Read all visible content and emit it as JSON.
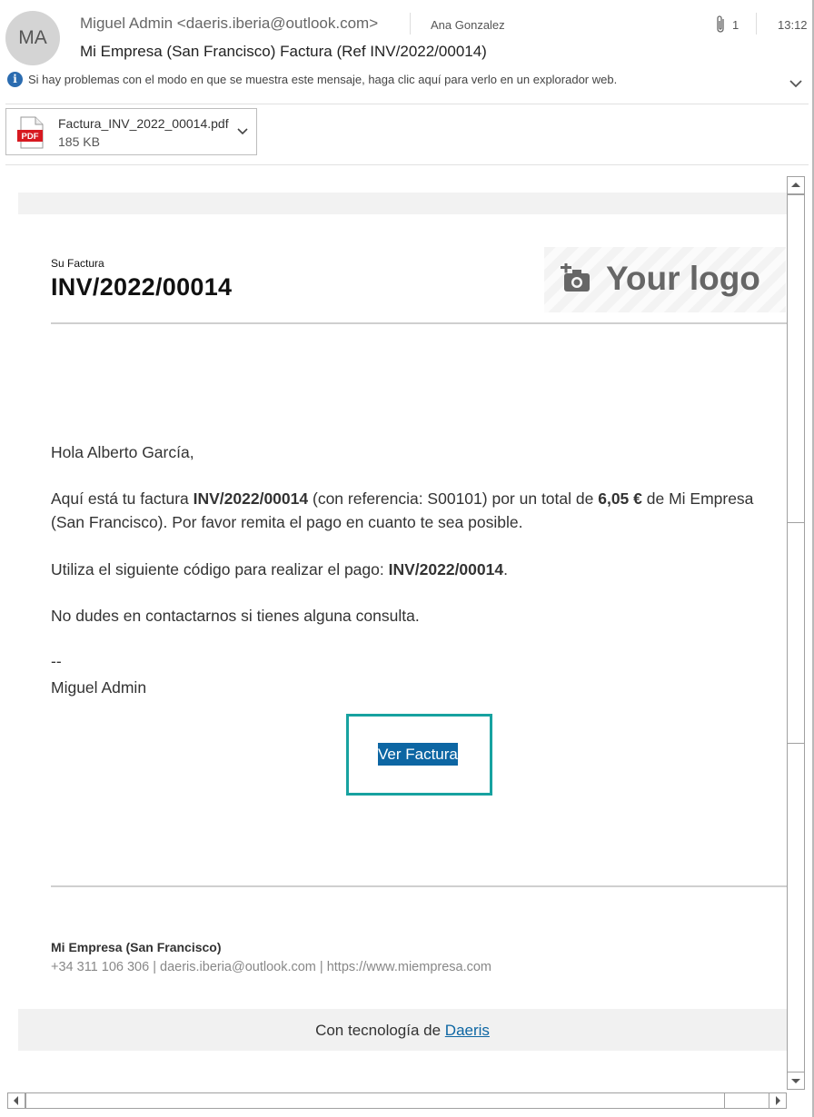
{
  "header": {
    "avatar_initials": "MA",
    "sender": "Miguel Admin <daeris.iberia@outlook.com>",
    "recipient": "Ana Gonzalez",
    "attachment_count": "1",
    "time": "13:12",
    "subject": "Mi Empresa (San Francisco) Factura  (Ref INV/2022/00014)",
    "info_text": "Si hay problemas con el modo en que se muestra este mensaje, haga clic aquí para verlo en un explorador web."
  },
  "attachment": {
    "file_name": "Factura_INV_2022_00014.pdf",
    "file_size": "185 KB",
    "icon_label": "PDF"
  },
  "email": {
    "label": "Su Factura",
    "invoice_number": "INV/2022/00014",
    "logo_text": "Your logo",
    "greeting": "Hola Alberto García,",
    "p1_a": "Aquí está tu factura ",
    "p1_invoice": "INV/2022/00014",
    "p1_b": " (con referencia: S00101) por un total de ",
    "p1_amount": "6,05 €",
    "p1_c": " de Mi Empresa (San Francisco). Por favor remita el pago en cuanto te sea posible.",
    "p2_a": "Utiliza el siguiente código para realizar el pago: ",
    "p2_code": "INV/2022/00014",
    "p2_b": ".",
    "p3": "No dudes en contactarnos si tienes alguna consulta.",
    "sig_dashes": "--",
    "sig_name": "Miguel Admin",
    "button_label": "Ver Factura",
    "company": "Mi Empresa (San Francisco)",
    "contact": "+34 311 106 306 | daeris.iberia@outlook.com | https://www.miempresa.com",
    "powered_prefix": "Con tecnología de ",
    "powered_link": "Daeris"
  },
  "colors": {
    "accent_blue": "#0d66a3",
    "highlight_teal": "#17a2a0",
    "pdf_red": "#d71920"
  }
}
